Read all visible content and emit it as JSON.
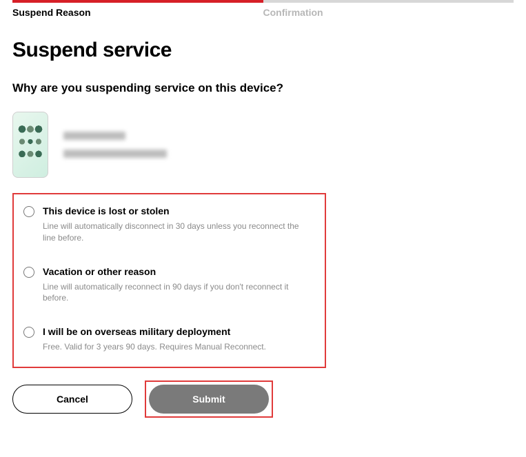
{
  "stepper": {
    "step1": "Suspend Reason",
    "step2": "Confirmation"
  },
  "heading": "Suspend service",
  "subheading": "Why are you suspending service on this device?",
  "options": [
    {
      "label": "This device is lost or stolen",
      "desc": "Line will automatically disconnect in 30 days unless you reconnect the line before."
    },
    {
      "label": "Vacation or other reason",
      "desc": "Line will automatically reconnect in 90 days if you don't reconnect it before."
    },
    {
      "label": "I will be on overseas military deployment",
      "desc": "Free. Valid for 3 years 90 days. Requires Manual Reconnect."
    }
  ],
  "buttons": {
    "cancel": "Cancel",
    "submit": "Submit"
  }
}
